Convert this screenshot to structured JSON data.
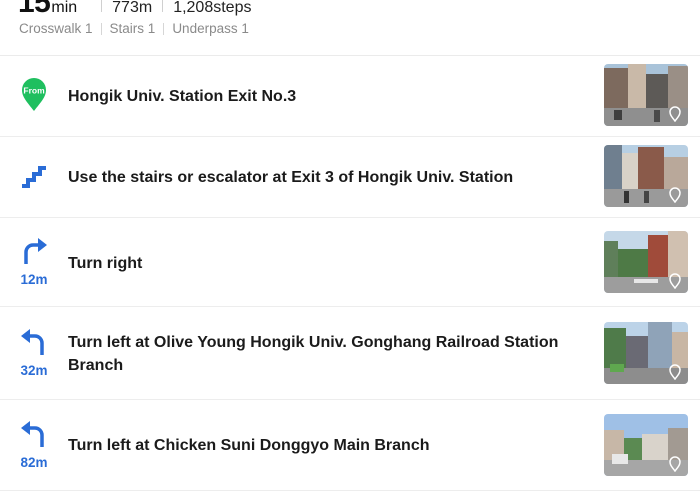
{
  "summary": {
    "time_value": "15",
    "time_unit": "min",
    "distance": "773m",
    "steps": "1,208steps",
    "facilities": [
      "Crosswalk 1",
      "Stairs 1",
      "Underpass 1"
    ]
  },
  "steps": [
    {
      "icon": "from-pin-icon",
      "badge": "From",
      "text": "Hongik Univ. Station Exit No.3",
      "distance": ""
    },
    {
      "icon": "stairs-icon",
      "text": "Use the stairs or escalator at Exit 3 of Hongik Univ. Station",
      "distance": ""
    },
    {
      "icon": "turn-right-icon",
      "text": "Turn right",
      "distance": "12m"
    },
    {
      "icon": "turn-left-icon",
      "text": "Turn left at Olive Young Hongik Univ. Gonghang Railroad Station Branch",
      "distance": "32m"
    },
    {
      "icon": "turn-left-icon",
      "text": "Turn left at Chicken Suni Donggyo Main Branch",
      "distance": "82m"
    }
  ],
  "colors": {
    "accent": "#2a6cd6",
    "from_pin": "#1fbf5f",
    "divider": "#ededed"
  }
}
